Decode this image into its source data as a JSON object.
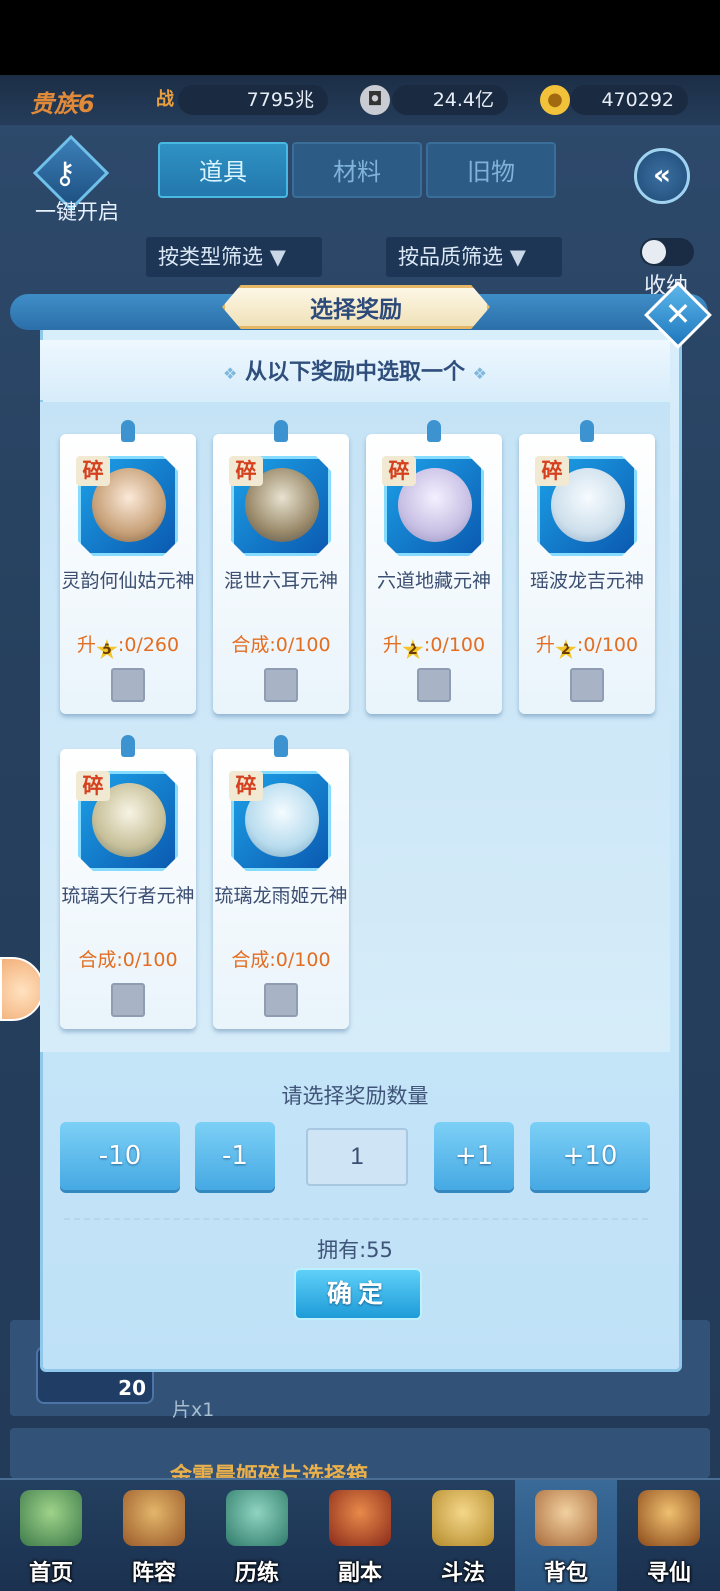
{
  "topbar": {
    "vip": "贵族6",
    "power_icon": "战",
    "power": "7795兆",
    "coins": "24.4亿",
    "ingots": "470292"
  },
  "toolbar": {
    "one_key_open": "一键开启",
    "tabs": [
      {
        "label": "道具",
        "active": true
      },
      {
        "label": "材料",
        "active": false
      },
      {
        "label": "旧物",
        "active": false
      }
    ],
    "filter_type": "按类型筛选",
    "filter_quality": "按品质筛选",
    "collapse": "收纳"
  },
  "background": {
    "item_text": "片x1",
    "item_badge": "20",
    "gold_title": "金雷晨姬碎片选择箱"
  },
  "modal": {
    "title": "选择奖励",
    "subtitle_left": "❖",
    "subtitle": "从以下奖励中选取一个",
    "subtitle_right": "❖",
    "fragment_label": "碎",
    "cards": [
      {
        "name": "灵韵何仙姑元神",
        "prefix": "升",
        "star": "5",
        "progress": ":0/260"
      },
      {
        "name": "混世六耳元神",
        "prefix": "",
        "star": "",
        "progress": "合成:0/100"
      },
      {
        "name": "六道地藏元神",
        "prefix": "升",
        "star": "2",
        "progress": ":0/100"
      },
      {
        "name": "瑶波龙吉元神",
        "prefix": "升",
        "star": "2",
        "progress": ":0/100"
      },
      {
        "name": "琉璃天行者元神",
        "prefix": "",
        "star": "",
        "progress": "合成:0/100"
      },
      {
        "name": "琉璃龙雨姬元神",
        "prefix": "",
        "star": "",
        "progress": "合成:0/100"
      }
    ],
    "qty_label": "请选择奖励数量",
    "qty_buttons": {
      "minus10": "-10",
      "minus1": "-1",
      "plus1": "+1",
      "plus10": "+10"
    },
    "qty_value": "1",
    "owned": "拥有:55",
    "confirm": "确定"
  },
  "nav": [
    {
      "label": "首页",
      "active": false
    },
    {
      "label": "阵容",
      "active": false
    },
    {
      "label": "历练",
      "active": false
    },
    {
      "label": "副本",
      "active": false
    },
    {
      "label": "斗法",
      "active": false
    },
    {
      "label": "背包",
      "active": true
    },
    {
      "label": "寻仙",
      "active": false
    }
  ],
  "colors": {
    "accent": "#2378ad",
    "progress": "#e36e22",
    "frag": "#d5401f"
  }
}
